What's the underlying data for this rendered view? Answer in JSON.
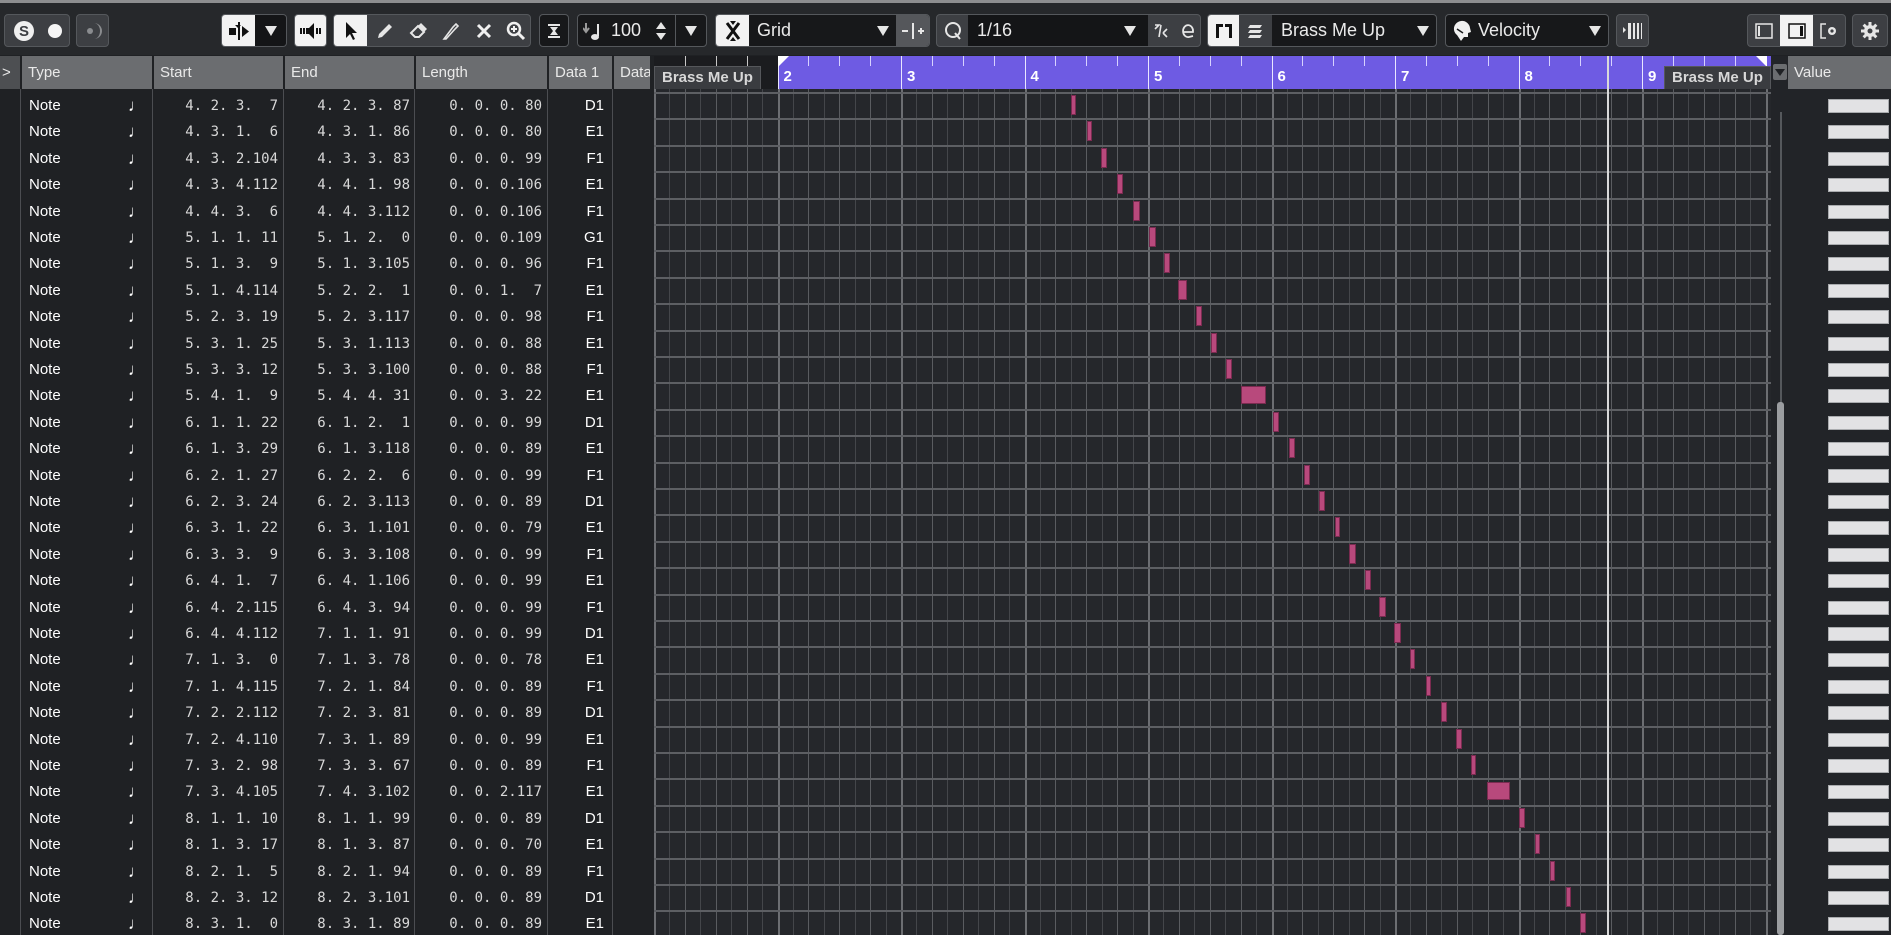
{
  "toolbar": {
    "solo_icon": "solo-s-icon",
    "record_icon": "record-dot-icon",
    "acoustic_feedback_icon": "moon-icon",
    "tools": [
      "object-selection",
      "draw",
      "erase",
      "trim",
      "mute",
      "zoom"
    ],
    "insert_velocity_label": "100",
    "snap_type": "Grid",
    "quantize_value": "1/16",
    "part_name": "Brass Me Up",
    "controller_lane": "Velocity"
  },
  "list": {
    "columns": [
      ">",
      "Type",
      "Start",
      "End",
      "Length",
      "Data 1",
      "Data"
    ],
    "rows": [
      {
        "type": "Note",
        "start": "4. 2. 3.  7",
        "end": "4. 2. 3. 87",
        "length": "0. 0. 0. 80",
        "data1": "D1"
      },
      {
        "type": "Note",
        "start": "4. 3. 1.  6",
        "end": "4. 3. 1. 86",
        "length": "0. 0. 0. 80",
        "data1": "E1"
      },
      {
        "type": "Note",
        "start": "4. 3. 2.104",
        "end": "4. 3. 3. 83",
        "length": "0. 0. 0. 99",
        "data1": "F1"
      },
      {
        "type": "Note",
        "start": "4. 3. 4.112",
        "end": "4. 4. 1. 98",
        "length": "0. 0. 0.106",
        "data1": "E1"
      },
      {
        "type": "Note",
        "start": "4. 4. 3.  6",
        "end": "4. 4. 3.112",
        "length": "0. 0. 0.106",
        "data1": "F1"
      },
      {
        "type": "Note",
        "start": "5. 1. 1. 11",
        "end": "5. 1. 2.  0",
        "length": "0. 0. 0.109",
        "data1": "G1"
      },
      {
        "type": "Note",
        "start": "5. 1. 3.  9",
        "end": "5. 1. 3.105",
        "length": "0. 0. 0. 96",
        "data1": "F1"
      },
      {
        "type": "Note",
        "start": "5. 1. 4.114",
        "end": "5. 2. 2.  1",
        "length": "0. 0. 1.  7",
        "data1": "E1"
      },
      {
        "type": "Note",
        "start": "5. 2. 3. 19",
        "end": "5. 2. 3.117",
        "length": "0. 0. 0. 98",
        "data1": "F1"
      },
      {
        "type": "Note",
        "start": "5. 3. 1. 25",
        "end": "5. 3. 1.113",
        "length": "0. 0. 0. 88",
        "data1": "E1"
      },
      {
        "type": "Note",
        "start": "5. 3. 3. 12",
        "end": "5. 3. 3.100",
        "length": "0. 0. 0. 88",
        "data1": "F1"
      },
      {
        "type": "Note",
        "start": "5. 4. 1.  9",
        "end": "5. 4. 4. 31",
        "length": "0. 0. 3. 22",
        "data1": "E1"
      },
      {
        "type": "Note",
        "start": "6. 1. 1. 22",
        "end": "6. 1. 2.  1",
        "length": "0. 0. 0. 99",
        "data1": "D1"
      },
      {
        "type": "Note",
        "start": "6. 1. 3. 29",
        "end": "6. 1. 3.118",
        "length": "0. 0. 0. 89",
        "data1": "E1"
      },
      {
        "type": "Note",
        "start": "6. 2. 1. 27",
        "end": "6. 2. 2.  6",
        "length": "0. 0. 0. 99",
        "data1": "F1"
      },
      {
        "type": "Note",
        "start": "6. 2. 3. 24",
        "end": "6. 2. 3.113",
        "length": "0. 0. 0. 89",
        "data1": "D1"
      },
      {
        "type": "Note",
        "start": "6. 3. 1. 22",
        "end": "6. 3. 1.101",
        "length": "0. 0. 0. 79",
        "data1": "E1"
      },
      {
        "type": "Note",
        "start": "6. 3. 3.  9",
        "end": "6. 3. 3.108",
        "length": "0. 0. 0. 99",
        "data1": "F1"
      },
      {
        "type": "Note",
        "start": "6. 4. 1.  7",
        "end": "6. 4. 1.106",
        "length": "0. 0. 0. 99",
        "data1": "E1"
      },
      {
        "type": "Note",
        "start": "6. 4. 2.115",
        "end": "6. 4. 3. 94",
        "length": "0. 0. 0. 99",
        "data1": "F1"
      },
      {
        "type": "Note",
        "start": "6. 4. 4.112",
        "end": "7. 1. 1. 91",
        "length": "0. 0. 0. 99",
        "data1": "D1"
      },
      {
        "type": "Note",
        "start": "7. 1. 3.  0",
        "end": "7. 1. 3. 78",
        "length": "0. 0. 0. 78",
        "data1": "E1"
      },
      {
        "type": "Note",
        "start": "7. 1. 4.115",
        "end": "7. 2. 1. 84",
        "length": "0. 0. 0. 89",
        "data1": "F1"
      },
      {
        "type": "Note",
        "start": "7. 2. 2.112",
        "end": "7. 2. 3. 81",
        "length": "0. 0. 0. 89",
        "data1": "D1"
      },
      {
        "type": "Note",
        "start": "7. 2. 4.110",
        "end": "7. 3. 1. 89",
        "length": "0. 0. 0. 99",
        "data1": "E1"
      },
      {
        "type": "Note",
        "start": "7. 3. 2. 98",
        "end": "7. 3. 3. 67",
        "length": "0. 0. 0. 89",
        "data1": "F1"
      },
      {
        "type": "Note",
        "start": "7. 3. 4.105",
        "end": "7. 4. 3.102",
        "length": "0. 0. 2.117",
        "data1": "E1"
      },
      {
        "type": "Note",
        "start": "8. 1. 1. 10",
        "end": "8. 1. 1. 99",
        "length": "0. 0. 0. 89",
        "data1": "D1"
      },
      {
        "type": "Note",
        "start": "8. 1. 3. 17",
        "end": "8. 1. 3. 87",
        "length": "0. 0. 0. 70",
        "data1": "E1"
      },
      {
        "type": "Note",
        "start": "8. 2. 1.  5",
        "end": "8. 2. 1. 94",
        "length": "0. 0. 0. 89",
        "data1": "F1"
      },
      {
        "type": "Note",
        "start": "8. 2. 3. 12",
        "end": "8. 2. 3.101",
        "length": "0. 0. 0. 89",
        "data1": "D1"
      },
      {
        "type": "Note",
        "start": "8. 3. 1.  0",
        "end": "8. 3. 1. 89",
        "length": "0. 0. 0. 89",
        "data1": "E1"
      }
    ]
  },
  "editor": {
    "ruler_bars": [
      "2",
      "3",
      "4",
      "5",
      "6",
      "7",
      "8",
      "9"
    ],
    "part_start_label": "Brass Me Up",
    "part_end_label": "Brass Me Up",
    "first_visible_bar": 1,
    "part_start_bar": 2,
    "cursor_position_bar": 8.7,
    "note_color": "#b8497c",
    "ruler_color": "#6e5be3"
  },
  "value_panel": {
    "header": "Value"
  }
}
